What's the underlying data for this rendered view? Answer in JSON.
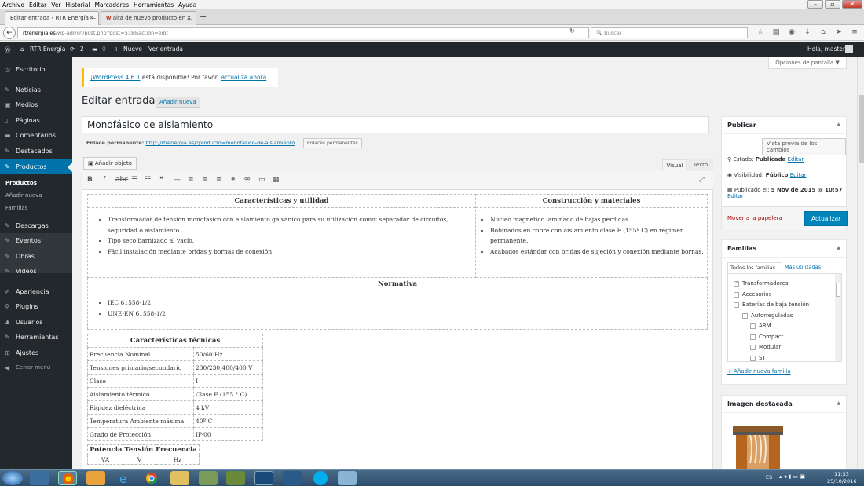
{
  "browser": {
    "menu": [
      {
        "label": "Archivo"
      },
      {
        "label": "Editar"
      },
      {
        "label": "Ver"
      },
      {
        "label": "Historial"
      },
      {
        "label": "Marcadores"
      },
      {
        "label": "Herramientas"
      },
      {
        "label": "Ayuda"
      }
    ],
    "tabs": [
      {
        "label": "Editar entrada ‹ RTR Energía — ..."
      },
      {
        "label": "alta de nuevo producto en ..."
      }
    ],
    "url_domain": "rtrenergia.es",
    "url_path": "/wp-admin/post.php?post=518&action=edit",
    "search_placeholder": "Buscar"
  },
  "adminbar": {
    "site": "RTR Energía",
    "updates": "2",
    "comments": "0",
    "new": "Nuevo",
    "view": "Ver entrada",
    "greeting": "Hola, master"
  },
  "sidebar": {
    "items": [
      {
        "label": "Escritorio",
        "icon": "dashboard-icon"
      },
      {
        "label": "Noticias",
        "icon": "pin-icon"
      },
      {
        "label": "Medios",
        "icon": "media-icon"
      },
      {
        "label": "Páginas",
        "icon": "page-icon"
      },
      {
        "label": "Comentarios",
        "icon": "comment-icon"
      },
      {
        "label": "Destacados",
        "icon": "pin-icon"
      },
      {
        "label": "Productos",
        "icon": "pin-icon"
      },
      {
        "label": "Descargas",
        "icon": "pin-icon"
      },
      {
        "label": "Eventos",
        "icon": "pin-icon"
      },
      {
        "label": "Obras",
        "icon": "pin-icon"
      },
      {
        "label": "Videos",
        "icon": "pin-icon"
      },
      {
        "label": "Apariencia",
        "icon": "brush-icon"
      },
      {
        "label": "Plugins",
        "icon": "plugin-icon"
      },
      {
        "label": "Usuarios",
        "icon": "user-icon"
      },
      {
        "label": "Herramientas",
        "icon": "wrench-icon"
      },
      {
        "label": "Ajustes",
        "icon": "settings-icon"
      },
      {
        "label": "Cerrar menú",
        "icon": "collapse-icon"
      }
    ],
    "submenu": [
      "Productos",
      "Añadir nueva",
      "Familias"
    ]
  },
  "notice": {
    "link1": "¡WordPress 4.6.1",
    "text": " está disponible! Por favor, ",
    "link2": "actualiza ahora",
    "end": "."
  },
  "screen_options": "Opciones de pantalla ▼",
  "page": {
    "title": "Editar entrada",
    "add_new": "Añadir nueva",
    "post_title": "Monofásico de aislamiento",
    "permalink_label": "Enlace permanente:",
    "permalink_url": "http://rtrenergia.es/?producto=monofasico-de-aislamiento",
    "permalink_button": "Enlaces permanentes",
    "add_media": "Añadir objeto",
    "tab_visual": "Visual",
    "tab_text": "Texto"
  },
  "content": {
    "h_features": "Características y utilidad",
    "h_construction": "Construcción y materiales",
    "features": [
      "Transformador de tensión monofásico con aislamiento galvánico para su utilización como: separador de circuitos, seguridad o aislamiento.",
      "Tipo seco barnizado al vacío.",
      "Fácil instalación mediante bridas y bornas de conexión."
    ],
    "construction": [
      "Núcleo magnético laminado de bajas pérdidas.",
      "Bobinados en cobre con aislamiento clase F (155º C) en régimen permanente.",
      "Acabados estándar con bridas de sujeción y conexión mediante bornas."
    ],
    "h_norm": "Normativa",
    "norms": [
      "IEC 61558-1/2",
      "UNE-EN 61558-1/2"
    ],
    "h_tech": "Características técnicas",
    "tech": [
      [
        "Frecuencia Nominal",
        "50/60 Hz"
      ],
      [
        "Tensiones primario/secundario",
        "230/230,400/400 V"
      ],
      [
        "Clase",
        "I"
      ],
      [
        "Aislamiento  térmico",
        "Clase F (155 ° C)"
      ],
      [
        "Rigidez dieléctrica",
        "4 kV"
      ],
      [
        "Temperatura Ambiente máxima",
        "40º C"
      ],
      [
        "Grado de Protección",
        "IP-00"
      ]
    ],
    "h_power": "Potencia Tensión Frecuencia",
    "power_cols": [
      "VA",
      "V",
      "Hz"
    ]
  },
  "publish": {
    "title": "Publicar",
    "preview": "Vista previa de los cambios",
    "status_label": "Estado: ",
    "status_value": "Publicada",
    "edit": "Editar",
    "visibility_label": "Visibilidad: ",
    "visibility_value": "Público",
    "published_label": "Publicado el: ",
    "published_value": "5 Nov de 2015 @ 10:57",
    "trash": "Mover a la papelera",
    "update": "Actualizar"
  },
  "families": {
    "title": "Familias",
    "tab_all": "Todos los familias",
    "tab_used": "Más utilizadas",
    "items": [
      {
        "label": "Transformadores",
        "checked": true,
        "level": 0
      },
      {
        "label": "Accesorios",
        "checked": false,
        "level": 0
      },
      {
        "label": "Baterías de baja tensión",
        "checked": false,
        "level": 0
      },
      {
        "label": "Autorreguladas",
        "checked": false,
        "level": 1
      },
      {
        "label": "ARM",
        "checked": false,
        "level": 2
      },
      {
        "label": "Compact",
        "checked": false,
        "level": 2
      },
      {
        "label": "Modular",
        "checked": false,
        "level": 2
      },
      {
        "label": "ST",
        "checked": false,
        "level": 2
      }
    ],
    "add_new": "+ Añadir nueva familia"
  },
  "featured": {
    "title": "Imagen destacada"
  },
  "taskbar": {
    "lang": "ES",
    "time": "11:33",
    "date": "25/10/2016"
  },
  "colors": {
    "accent": "#0073aa",
    "admin_bar": "#23282d",
    "active": "#0073aa",
    "warning": "#ffb900"
  }
}
